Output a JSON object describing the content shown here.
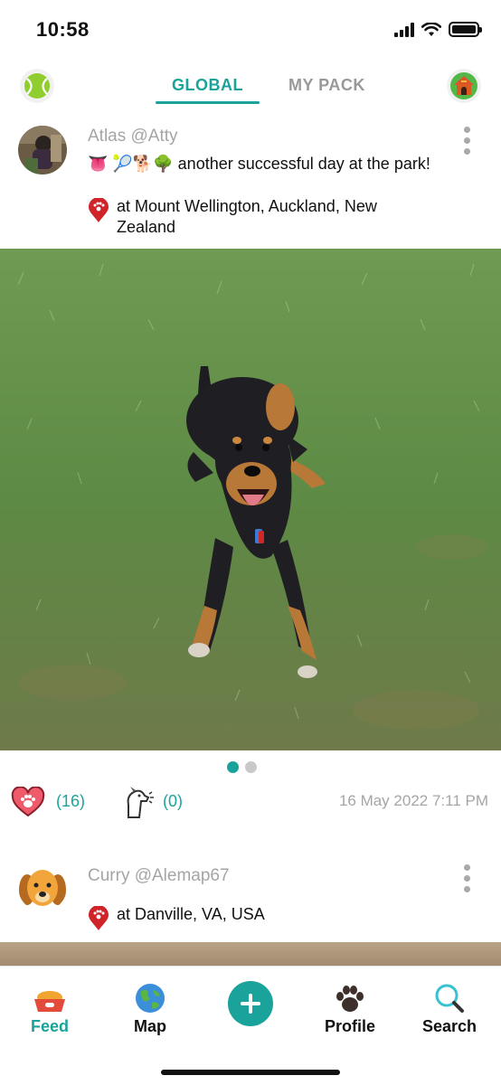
{
  "status_bar": {
    "time": "10:58"
  },
  "header": {
    "tabs": [
      {
        "label": "GLOBAL",
        "active": true
      },
      {
        "label": "MY PACK",
        "active": false
      }
    ]
  },
  "posts": [
    {
      "username": "Atlas @Atty",
      "caption_emojis": "👅 🎾🐕🌳",
      "caption": "another successful day at the park!",
      "location": "at Mount Wellington, Auckland, New Zealand",
      "likes": "(16)",
      "sniffs": "(0)",
      "timestamp": "16 May 2022 7:11 PM",
      "photo_count": 2,
      "photo_index": 0
    },
    {
      "username": "Curry @Alemap67",
      "location": "at Danville, VA, USA"
    }
  ],
  "bottom_nav": [
    {
      "label": "Feed",
      "icon": "dog-bowl-icon",
      "active": true
    },
    {
      "label": "Map",
      "icon": "globe-icon",
      "active": false
    },
    {
      "label": "",
      "icon": "plus-icon",
      "active": false
    },
    {
      "label": "Profile",
      "icon": "paw-icon",
      "active": false
    },
    {
      "label": "Search",
      "icon": "search-icon",
      "active": false
    }
  ],
  "colors": {
    "accent": "#1aa39a",
    "muted": "#a5a5a5",
    "pin": "#d0242b"
  }
}
